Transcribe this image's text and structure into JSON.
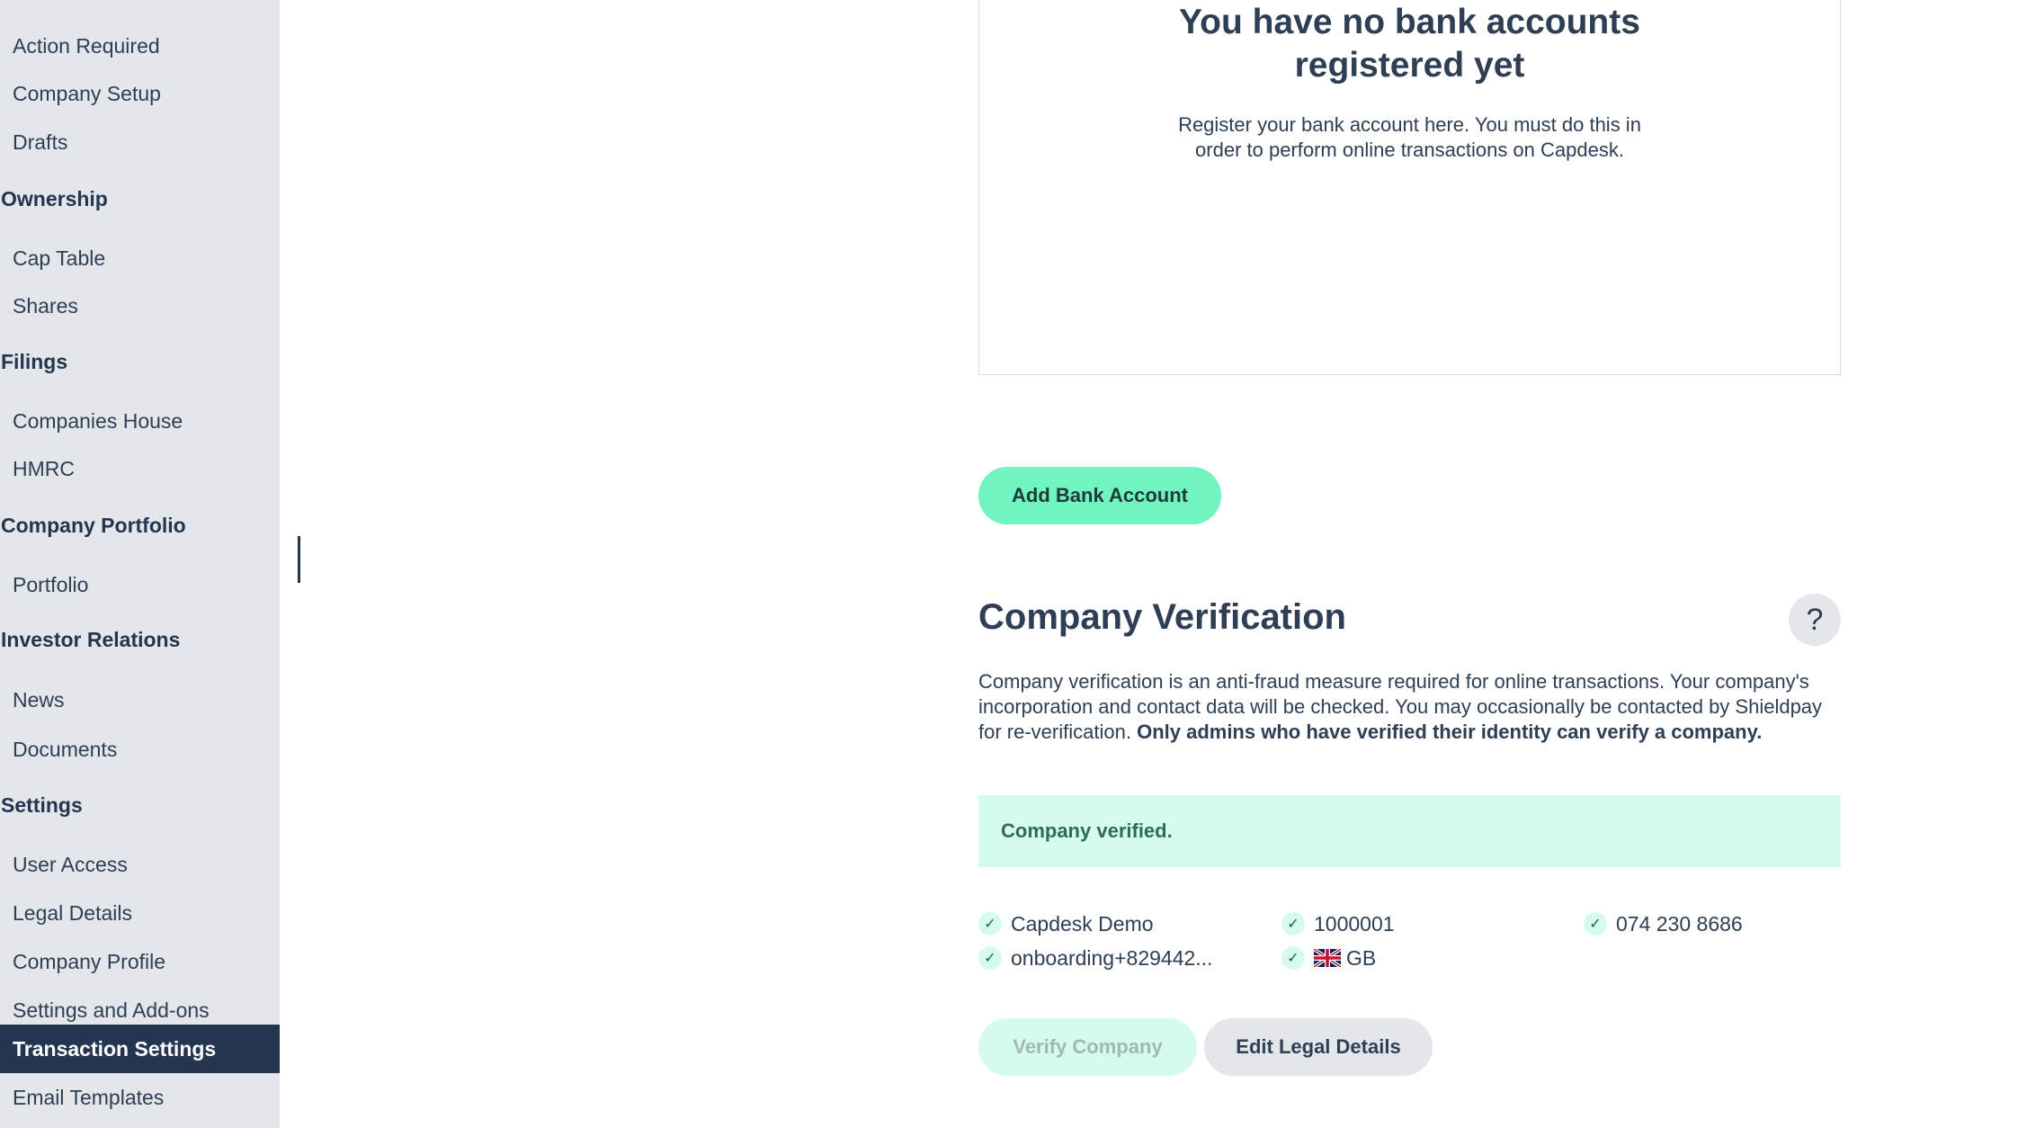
{
  "sidebar": {
    "rows": [
      {
        "kind": "item",
        "label": "Action Required"
      },
      {
        "kind": "item",
        "label": "Company Setup"
      },
      {
        "kind": "item",
        "label": "Drafts"
      },
      {
        "kind": "heading",
        "label": "Ownership"
      },
      {
        "kind": "item",
        "label": "Cap Table"
      },
      {
        "kind": "item",
        "label": "Shares"
      },
      {
        "kind": "heading",
        "label": "Filings"
      },
      {
        "kind": "item",
        "label": "Companies House"
      },
      {
        "kind": "item",
        "label": "HMRC"
      },
      {
        "kind": "heading",
        "label": "Company Portfolio"
      },
      {
        "kind": "item",
        "label": "Portfolio"
      },
      {
        "kind": "heading",
        "label": "Investor Relations"
      },
      {
        "kind": "item",
        "label": "News"
      },
      {
        "kind": "item",
        "label": "Documents"
      },
      {
        "kind": "heading",
        "label": "Settings"
      },
      {
        "kind": "item",
        "label": "User Access"
      },
      {
        "kind": "item",
        "label": "Legal Details"
      },
      {
        "kind": "item",
        "label": "Company Profile"
      },
      {
        "kind": "item",
        "label": "Settings and Add-ons"
      },
      {
        "kind": "item",
        "label": "Transaction Settings",
        "active": true
      },
      {
        "kind": "item",
        "label": "Email Templates"
      }
    ]
  },
  "bank_accounts": {
    "empty_title": "You have no bank accounts registered yet",
    "empty_description": "Register your bank account here. You must do this in order to perform online transactions on Capdesk.",
    "add_button": "Add Bank Account"
  },
  "verification": {
    "title": "Company Verification",
    "help_label": "?",
    "description": "Company verification is an anti-fraud measure required for online transactions. Your company's incorporation and contact data will be checked. You may occasionally be contacted by Shieldpay for re-verification.",
    "description_bold": "Only admins who have verified their identity can verify a company.",
    "status": "Company verified.",
    "checks": {
      "company_name": "Capdesk Demo",
      "company_number": "1000001",
      "phone": "074 230 8686",
      "email": "onboarding+829442...",
      "country": "GB"
    },
    "check_icon": "checkmark-icon",
    "flag_icon": "uk-flag-icon",
    "verify_button": "Verify Company",
    "edit_button": "Edit Legal Details"
  },
  "colors": {
    "sidebar_bg": "#e3e6ea",
    "sidebar_active": "#243550",
    "accent_green": "#70f5bf",
    "success_bg": "#d5fbef",
    "text": "#2e3e55"
  }
}
